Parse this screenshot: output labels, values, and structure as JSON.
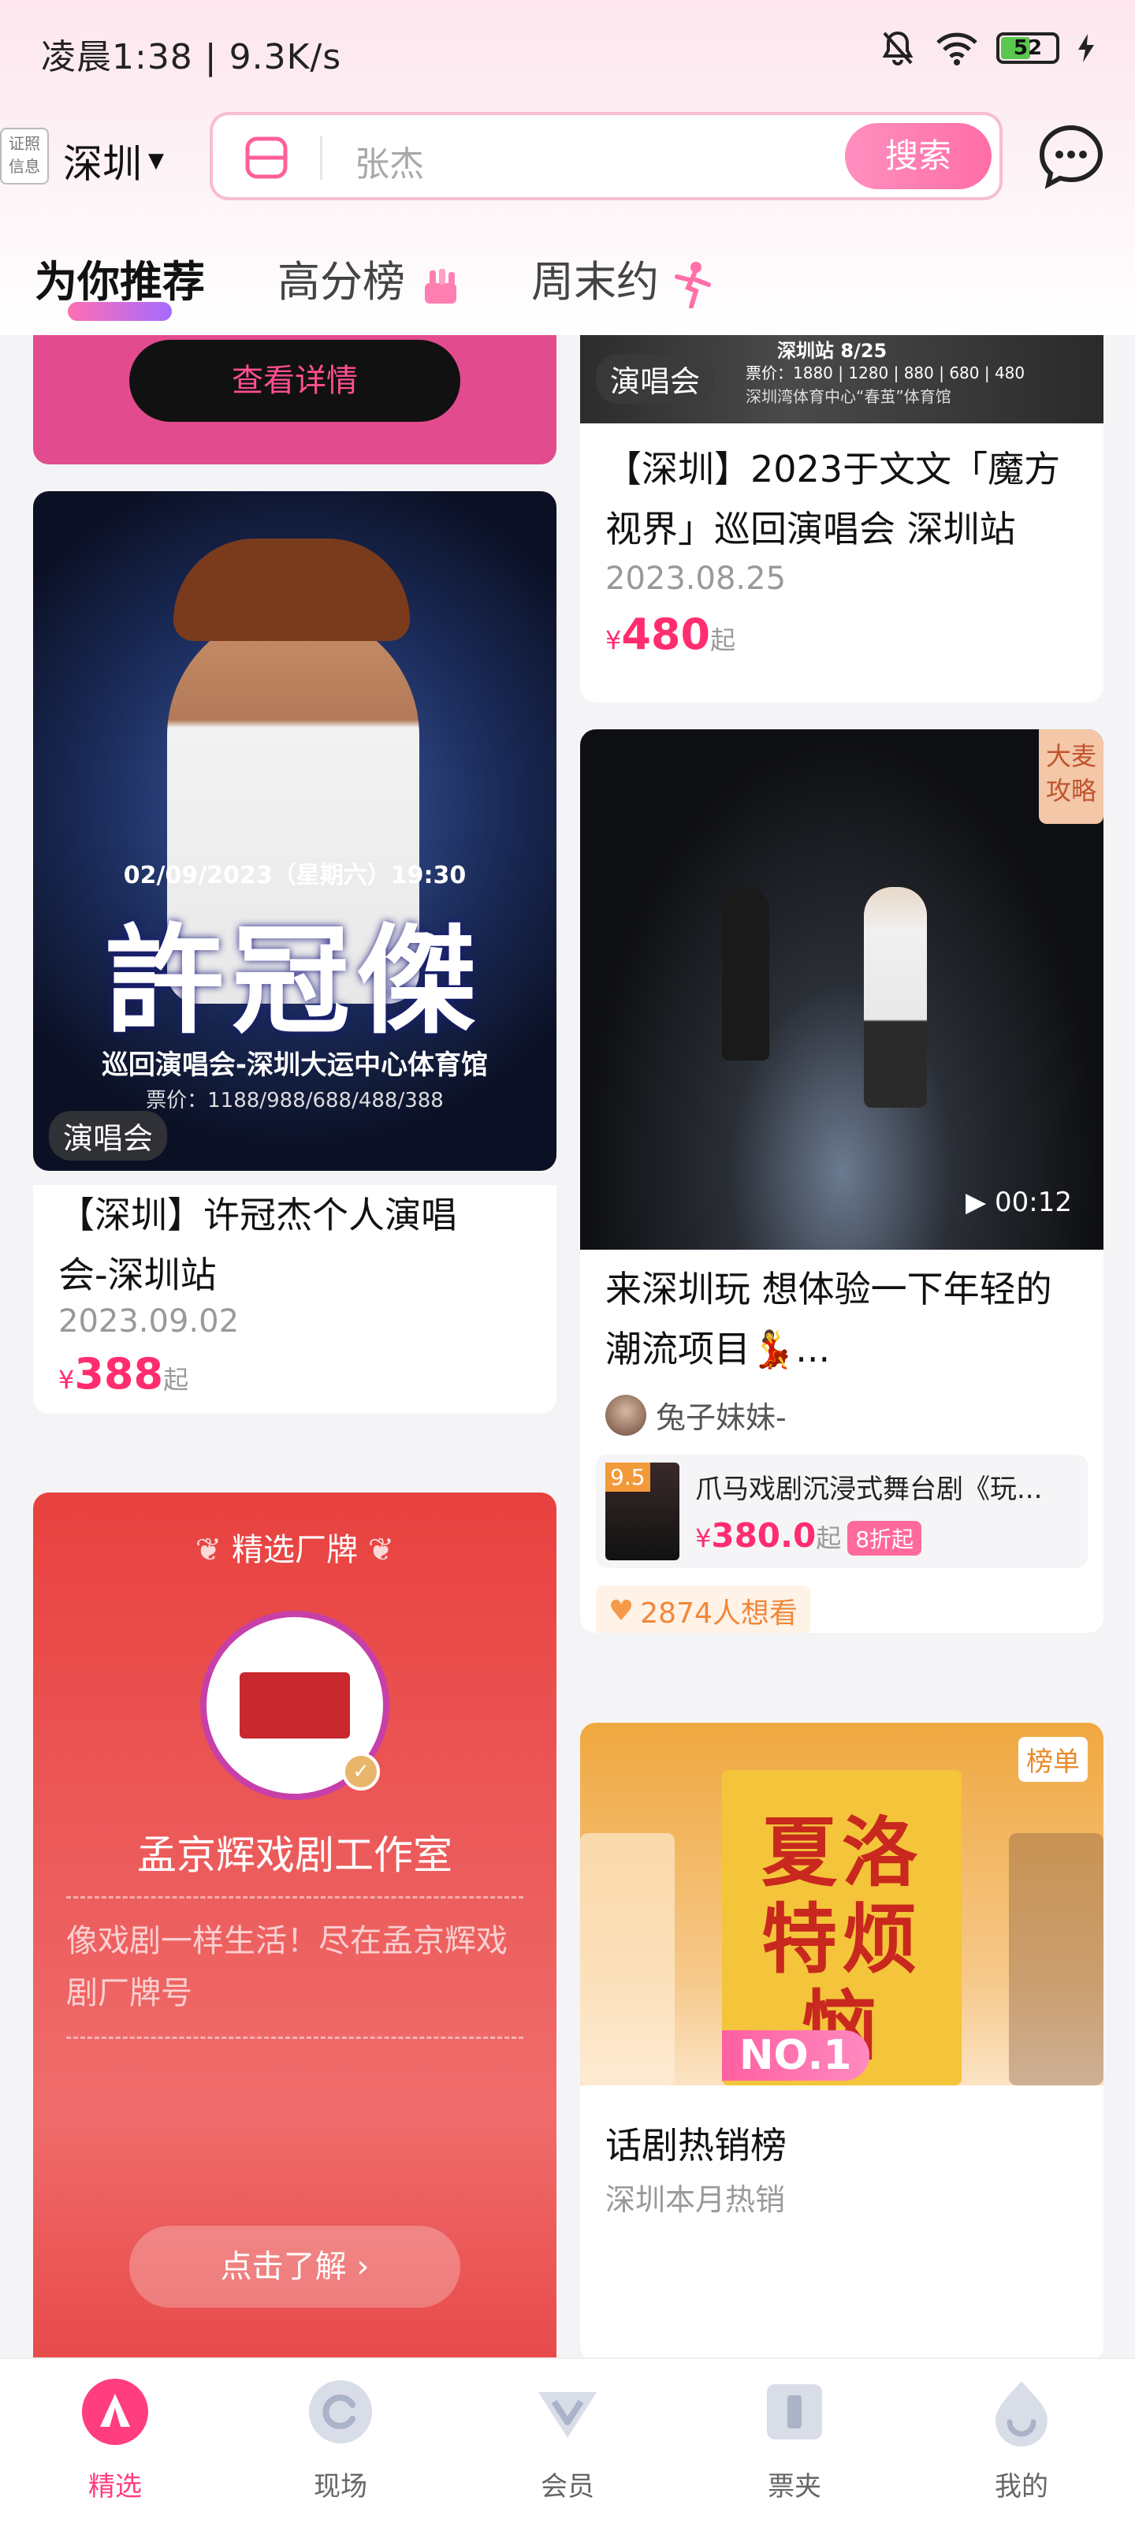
{
  "status": {
    "time": "凌晨1:38 | 9.3K/s",
    "battery": "52"
  },
  "header": {
    "loc_badge": [
      "证照",
      "信息"
    ],
    "city": "深圳",
    "search_placeholder": "张杰",
    "search_button": "搜索"
  },
  "tabs": [
    {
      "label": "为你推荐",
      "active": true
    },
    {
      "label": "高分榜",
      "active": false
    },
    {
      "label": "周末约",
      "active": false
    }
  ],
  "feed": {
    "promo_top": {
      "button": "查看详情"
    },
    "concert_small": {
      "tag": "演唱会",
      "title": "【深圳】2023于文文「魔方视界」巡回演唱会 深圳站",
      "date": "2023.08.25",
      "price": "480",
      "price_prefix": "¥",
      "suffix": "起",
      "poster_lines": [
        "深圳站 8/25",
        "票价：1880 | 1280 | 880 | 680 | 480",
        "深圳湾体育中心“春茧”体育馆"
      ]
    },
    "concert_large": {
      "tag": "演唱会",
      "title": "【深圳】许冠杰个人演唱会-深圳站",
      "date": "2023.09.02",
      "price": "388",
      "price_prefix": "¥",
      "suffix": "起",
      "poster_date": "02/09/2023（星期六）19:30",
      "poster_name": "許冠傑",
      "poster_venue": "巡回演唱会-深圳大运中心体育馆",
      "poster_prices": "票价：1188/988/688/488/388"
    },
    "video_card": {
      "corner_tag": [
        "大麦",
        "攻略"
      ],
      "duration": "00:12",
      "title": "来深圳玩  想体验一下年轻的潮流项目💃...",
      "author": "兔子妹妹-",
      "product": {
        "score": "9.5",
        "name": "爪马戏剧沉浸式舞台剧《玩...",
        "price": "380.0",
        "price_prefix": "¥",
        "suffix": "起",
        "discount": "8折起"
      },
      "wants": "2874人想看"
    },
    "brand_card": {
      "header": "精选厂牌",
      "name": "孟京辉戏剧工作室",
      "desc": "像戏剧一样生活！尽在孟京辉戏剧厂牌号",
      "button": "点击了解"
    },
    "rank_card": {
      "corner_tag": "榜单",
      "rank": "NO.1",
      "poster_title": "夏洛特烦恼",
      "title": "话剧热销榜",
      "subtitle": "深圳本月热销"
    }
  },
  "bottom_nav": [
    {
      "label": "精选",
      "active": true
    },
    {
      "label": "现场",
      "active": false
    },
    {
      "label": "会员",
      "active": false
    },
    {
      "label": "票夹",
      "active": false
    },
    {
      "label": "我的",
      "active": false
    }
  ]
}
